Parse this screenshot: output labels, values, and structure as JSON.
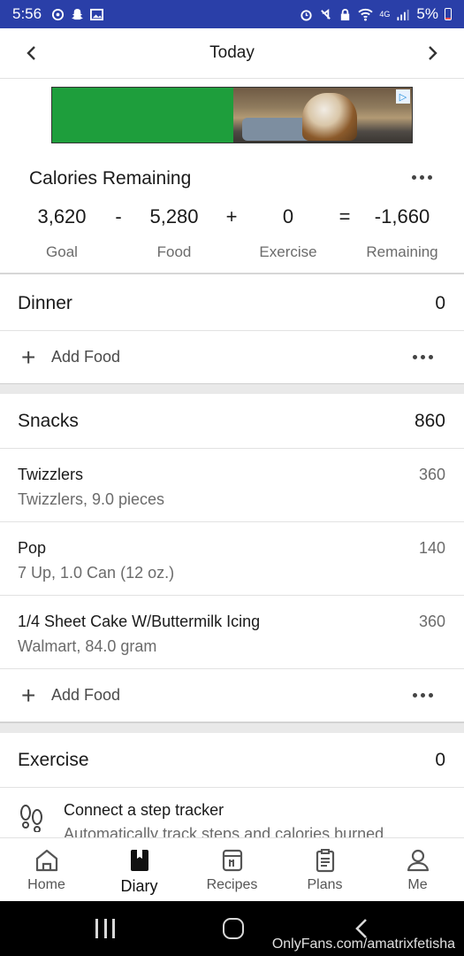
{
  "status_bar": {
    "time": "5:56",
    "battery": "5%",
    "network": "4G"
  },
  "header": {
    "title": "Today",
    "prev_icon": "chevron-left-icon",
    "next_icon": "chevron-right-icon"
  },
  "ad": {
    "badge_icon": "ad-choices-icon"
  },
  "calories": {
    "title": "Calories Remaining",
    "goal": {
      "value": "3,620",
      "label": "Goal"
    },
    "minus": "-",
    "food": {
      "value": "5,280",
      "label": "Food"
    },
    "plus": "+",
    "exercise": {
      "value": "0",
      "label": "Exercise"
    },
    "equals": "=",
    "remaining": {
      "value": "-1,660",
      "label": "Remaining"
    }
  },
  "dinner": {
    "title": "Dinner",
    "total": "0",
    "add_label": "Add Food"
  },
  "snacks": {
    "title": "Snacks",
    "total": "860",
    "items": [
      {
        "name": "Twizzlers",
        "desc": "Twizzlers, 9.0 pieces",
        "calories": "360"
      },
      {
        "name": "Pop",
        "desc": "7 Up, 1.0 Can (12 oz.)",
        "calories": "140"
      },
      {
        "name": "1/4 Sheet Cake W/Buttermilk Icing",
        "desc": "Walmart, 84.0 gram",
        "calories": "360"
      }
    ],
    "add_label": "Add Food"
  },
  "exercise": {
    "title": "Exercise",
    "total": "0",
    "tracker_title": "Connect a step tracker",
    "tracker_desc": "Automatically track steps and calories burned"
  },
  "bottom_nav": [
    {
      "label": "Home",
      "icon": "home-icon",
      "active": false
    },
    {
      "label": "Diary",
      "icon": "diary-icon",
      "active": true
    },
    {
      "label": "Recipes",
      "icon": "recipes-icon",
      "active": false
    },
    {
      "label": "Plans",
      "icon": "plans-icon",
      "active": false
    },
    {
      "label": "Me",
      "icon": "profile-icon",
      "active": false
    }
  ],
  "watermark": "OnlyFans.com/amatrixfetisha",
  "colors": {
    "status_bar": "#2a3fa8",
    "ad_green": "#1e9e3c",
    "text_primary": "#1a1a1a",
    "text_secondary": "#6b6b6b"
  }
}
